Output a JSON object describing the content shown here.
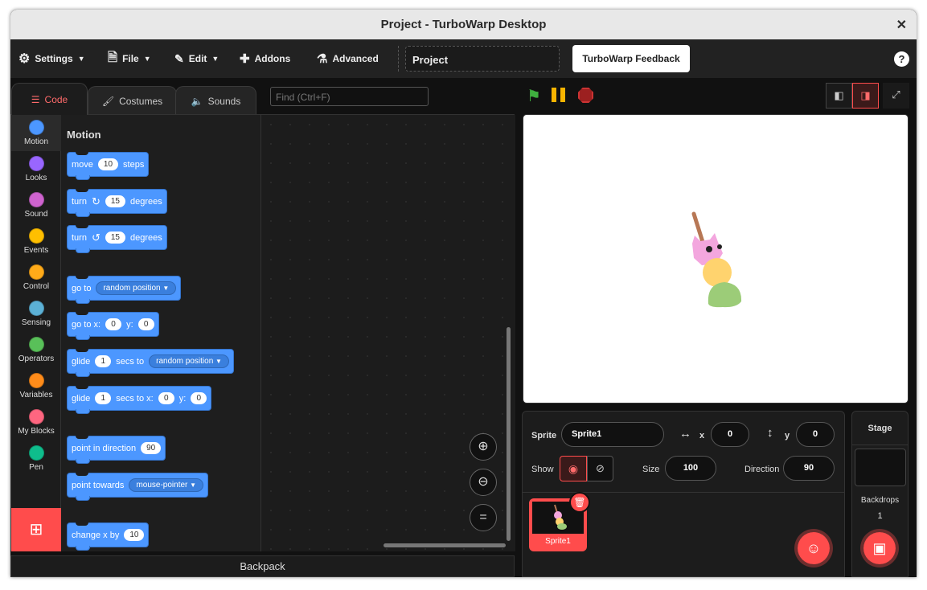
{
  "window": {
    "title": "Project - TurboWarp Desktop",
    "close_glyph": "✕"
  },
  "menu": {
    "settings": "Settings",
    "file": "File",
    "edit": "Edit",
    "addons": "Addons",
    "advanced": "Advanced",
    "project_name": "Project",
    "feedback": "TurboWarp Feedback",
    "help": "?"
  },
  "tabs": {
    "code": "Code",
    "costumes": "Costumes",
    "sounds": "Sounds"
  },
  "find": {
    "placeholder": "Find (Ctrl+F)"
  },
  "categories": [
    {
      "label": "Motion",
      "color": "#4c97ff"
    },
    {
      "label": "Looks",
      "color": "#9966ff"
    },
    {
      "label": "Sound",
      "color": "#cf63cf"
    },
    {
      "label": "Events",
      "color": "#ffbf00"
    },
    {
      "label": "Control",
      "color": "#ffab19"
    },
    {
      "label": "Sensing",
      "color": "#5cb1d6"
    },
    {
      "label": "Operators",
      "color": "#59c059"
    },
    {
      "label": "Variables",
      "color": "#ff8c1a"
    },
    {
      "label": "My Blocks",
      "color": "#ff6680"
    },
    {
      "label": "Pen",
      "color": "#0fbd8c"
    }
  ],
  "palette": {
    "heading": "Motion",
    "move": {
      "a": "move",
      "n": "10",
      "b": "steps"
    },
    "turn_right": {
      "a": "turn",
      "n": "15",
      "b": "degrees"
    },
    "turn_left": {
      "a": "turn",
      "n": "15",
      "b": "degrees"
    },
    "goto": {
      "a": "go to",
      "dd": "random position"
    },
    "gotoxy": {
      "a": "go to x:",
      "x": "0",
      "b": "y:",
      "y": "0"
    },
    "glide": {
      "a": "glide",
      "n": "1",
      "b": "secs to",
      "dd": "random position"
    },
    "glidexy": {
      "a": "glide",
      "n": "1",
      "b": "secs to x:",
      "x": "0",
      "c": "y:",
      "y": "0"
    },
    "point_dir": {
      "a": "point in direction",
      "n": "90"
    },
    "point_towards": {
      "a": "point towards",
      "dd": "mouse-pointer"
    },
    "changex": {
      "a": "change x by",
      "n": "10"
    }
  },
  "backpack": "Backpack",
  "sprite_info": {
    "sprite_label": "Sprite",
    "sprite_name": "Sprite1",
    "x_label": "x",
    "x": "0",
    "y_label": "y",
    "y": "0",
    "show_label": "Show",
    "size_label": "Size",
    "size": "100",
    "direction_label": "Direction",
    "direction": "90"
  },
  "sprites": [
    {
      "name": "Sprite1"
    }
  ],
  "stage_panel": {
    "title": "Stage",
    "backdrops_label": "Backdrops",
    "backdrops_count": "1"
  },
  "colors": {
    "accent": "#ff4c4c",
    "motion": "#4c97ff"
  }
}
